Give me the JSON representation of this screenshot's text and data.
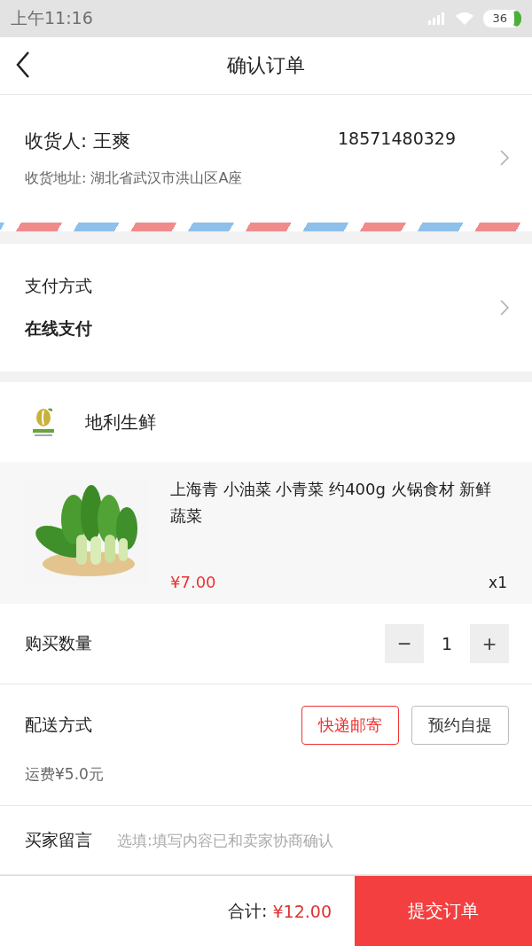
{
  "status_bar": {
    "time": "上午11:16",
    "battery": "36"
  },
  "header": {
    "title": "确认订单"
  },
  "address": {
    "receiver": "收货人: 王爽",
    "phone": "18571480329",
    "address": "收货地址: 湖北省武汉市洪山区A座"
  },
  "payment": {
    "label": "支付方式",
    "value": "在线支付"
  },
  "shop": {
    "name": "地利生鲜"
  },
  "product": {
    "kind": "picture",
    "title": "上海青 小油菜 小青菜 约400g 火锅食材 新鲜蔬菜",
    "price": "¥7.00",
    "quantity": "x1"
  },
  "quantity_row": {
    "label": "购买数量",
    "minus": "−",
    "value": "1",
    "plus": "+"
  },
  "delivery": {
    "label": "配送方式",
    "options": [
      {
        "label": "快递邮寄",
        "selected": true
      },
      {
        "label": "预约自提",
        "selected": false
      }
    ],
    "fee": "运费¥5.0元"
  },
  "message": {
    "label": "买家留言",
    "placeholder": "选填:填写内容已和卖家协商确认"
  },
  "footer": {
    "total_label": "合计:",
    "total": "¥12.00",
    "submit": "提交订单"
  }
}
